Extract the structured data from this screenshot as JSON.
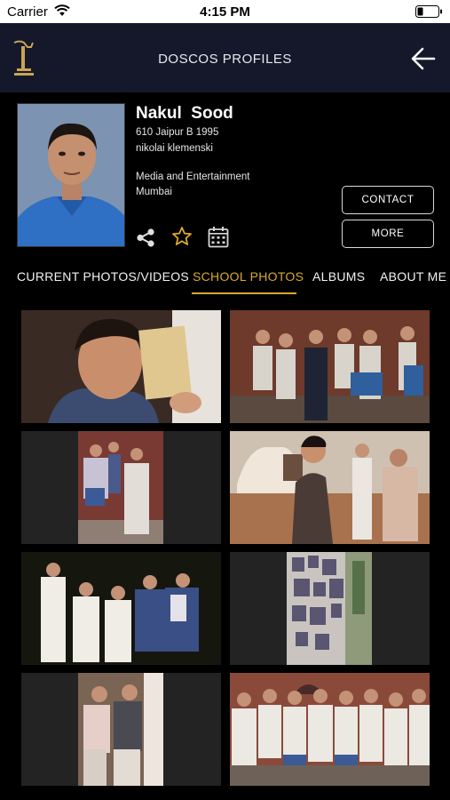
{
  "status_bar": {
    "carrier": "Carrier",
    "time": "4:15 PM"
  },
  "nav": {
    "title": "DOSCOS PROFILES"
  },
  "profile": {
    "name": "Nakul  Sood",
    "house_line": "610 Jaipur B 1995",
    "nickname": "nikolai klemenski",
    "industry": "Media and Entertainment",
    "city": "Mumbai"
  },
  "actions": {
    "contact_label": "CONTACT",
    "more_label": "MORE"
  },
  "icons": [
    "wifi-icon",
    "battery-icon",
    "school-logo-icon",
    "back-arrow-icon",
    "share-icon",
    "star-icon",
    "calendar-icon"
  ],
  "colors": {
    "accent": "#d9a92e",
    "nav_bg": "#14182a",
    "background": "#000000"
  },
  "tabs": [
    {
      "label": "CURRENT PHOTOS/VIDEOS",
      "active": false
    },
    {
      "label": "SCHOOL PHOTOS",
      "active": true
    },
    {
      "label": "ALBUMS",
      "active": false
    },
    {
      "label": "ABOUT ME",
      "active": false
    }
  ],
  "photos": [
    {
      "name": "school-photo-1"
    },
    {
      "name": "school-photo-2"
    },
    {
      "name": "school-photo-3"
    },
    {
      "name": "school-photo-4"
    },
    {
      "name": "school-photo-5"
    },
    {
      "name": "school-photo-6"
    },
    {
      "name": "school-photo-7"
    },
    {
      "name": "school-photo-8"
    }
  ]
}
